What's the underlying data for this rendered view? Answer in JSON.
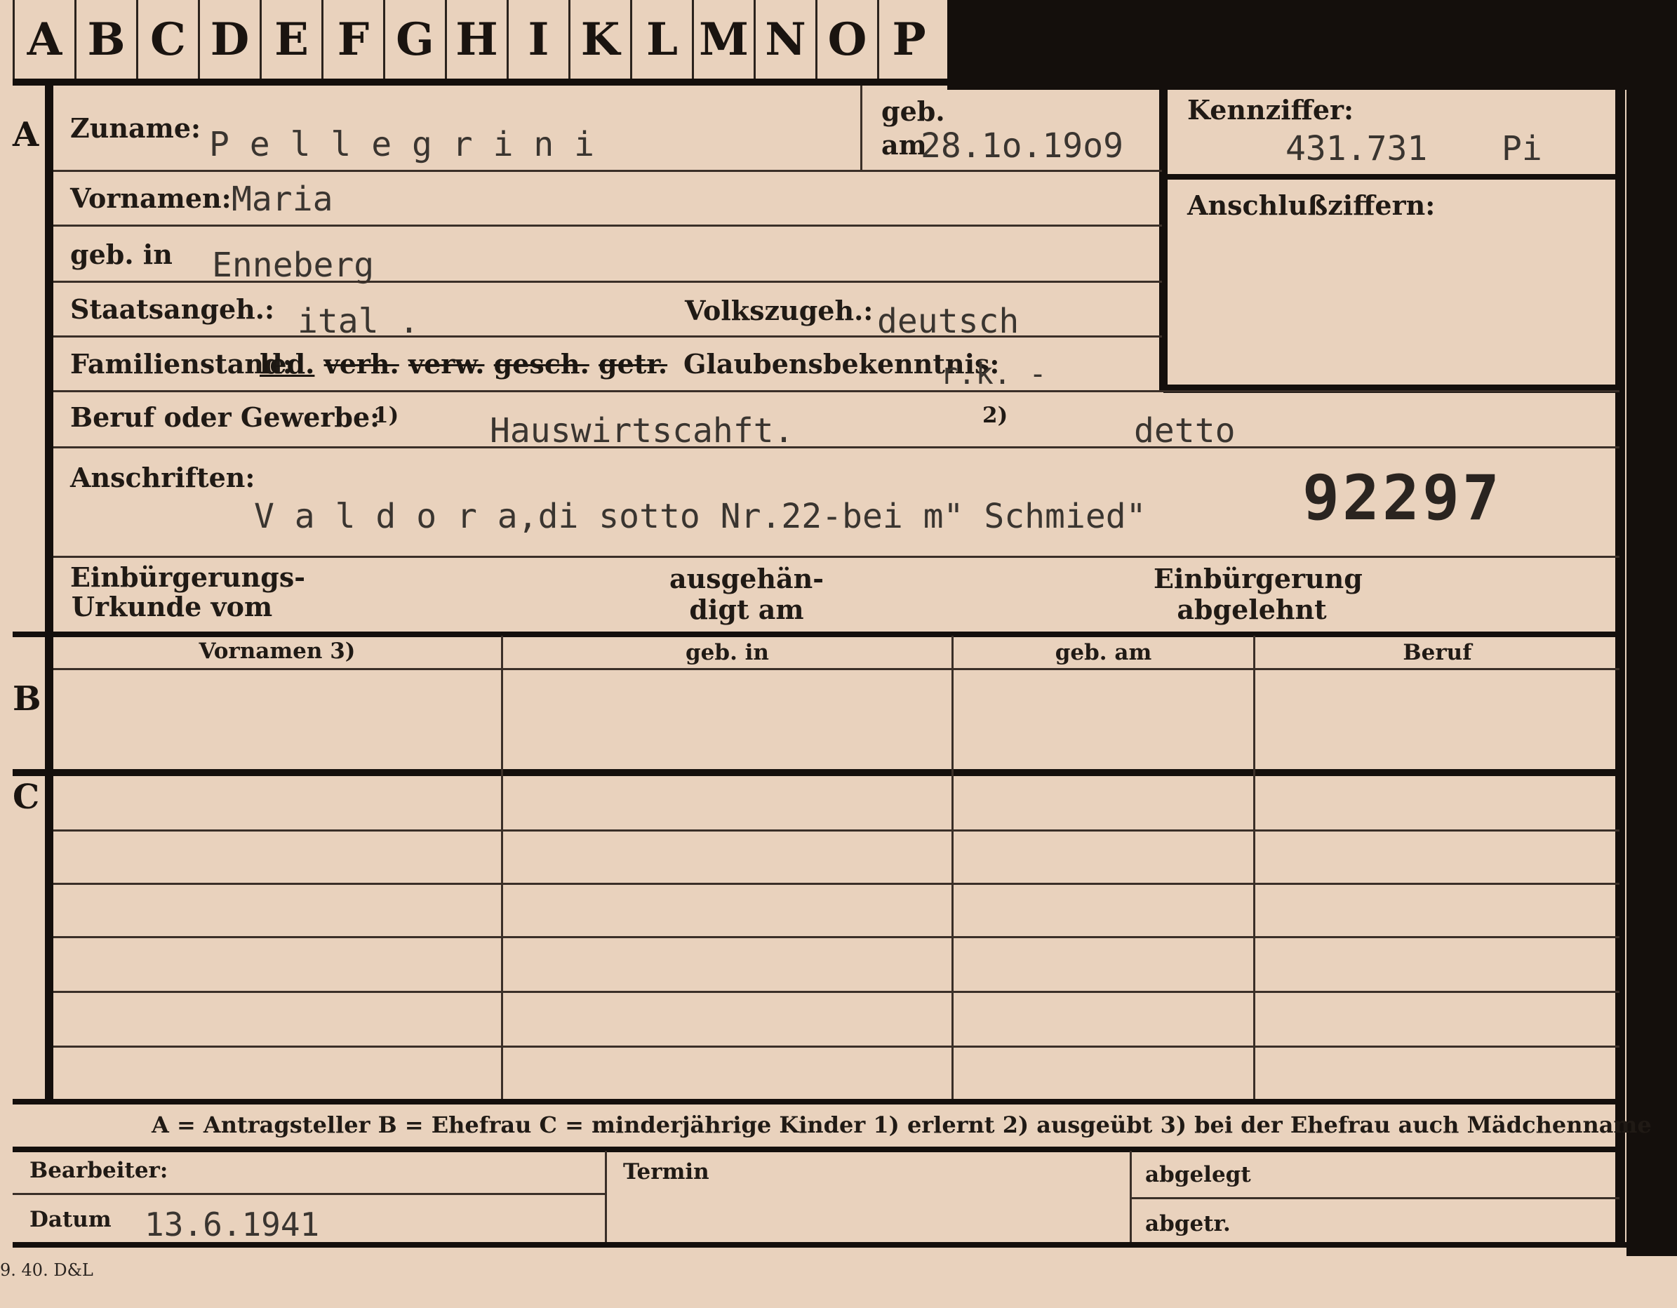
{
  "index_tabs": [
    "A",
    "B",
    "C",
    "D",
    "E",
    "F",
    "G",
    "H",
    "I",
    "K",
    "L",
    "M",
    "N",
    "O",
    "P"
  ],
  "sections": {
    "a": "A",
    "b": "B",
    "c": "C"
  },
  "header": {
    "zuname_label": "Zuname:",
    "zuname_value": "P e l l e g r i n i",
    "geb_label": "geb.",
    "am_label": "am",
    "geb_am_value": "28.1o.19o9",
    "kennziffer_label": "Kennziffer:",
    "kennziffer_value": "431.731",
    "kennziffer_suffix": "Pi",
    "anschluss_label": "Anschlußziffern:"
  },
  "personal": {
    "vornamen_label": "Vornamen:",
    "vornamen_value": "Maria",
    "geb_in_label": "geb. in",
    "geb_in_value": "Enneberg",
    "staatsangeh_label": "Staatsangeh.:",
    "staatsangeh_value": "ital .",
    "volkszugeh_label": "Volkszugeh.:",
    "volkszugeh_value": "deutsch",
    "familienstand_label": "Familienstand:",
    "familienstand_options": [
      "led.",
      "verh.",
      "verw.",
      "gesch.",
      "getr."
    ],
    "glaubens_label": "Glaubensbekenntnis:",
    "glaubens_value": "r.k. -",
    "beruf_label": "Beruf oder Gewerbe:",
    "beruf_note1": "1)",
    "beruf_value1": "Hauswirtscahft.",
    "beruf_note2": "2)",
    "beruf_value2": "detto",
    "anschriften_label": "Anschriften:",
    "anschriften_value": "V a l d o r a,di sotto Nr.22-bei m\" Schmied\"",
    "stamp_number": "92297"
  },
  "naturalization": {
    "urkunde_line1": "Einbürgerungs-",
    "urkunde_line2": "Urkunde vom",
    "ausgehaendigt_line1": "ausgehän-",
    "ausgehaendigt_line2": "digt am",
    "abgelehnt_line1": "Einbürgerung",
    "abgelehnt_line2": "abgelehnt"
  },
  "table": {
    "columns": [
      "Vornamen 3)",
      "geb. in",
      "geb. am",
      "Beruf"
    ]
  },
  "legend": "A = Antragsteller   B = Ehefrau   C = minderjährige Kinder   1) erlernt   2) ausgeübt   3) bei der Ehefrau auch Mädchenname",
  "footer": {
    "bearbeiter_label": "Bearbeiter:",
    "datum_label": "Datum",
    "datum_value": "13.6.1941",
    "termin_label": "Termin",
    "abgelegt_label": "abgelegt",
    "abgetr_label": "abgetr.",
    "print_code": "9. 40. D&L"
  },
  "colors": {
    "card": "#e9d2bd",
    "ink": "#140f0c",
    "typewriter": "#3a3530"
  }
}
